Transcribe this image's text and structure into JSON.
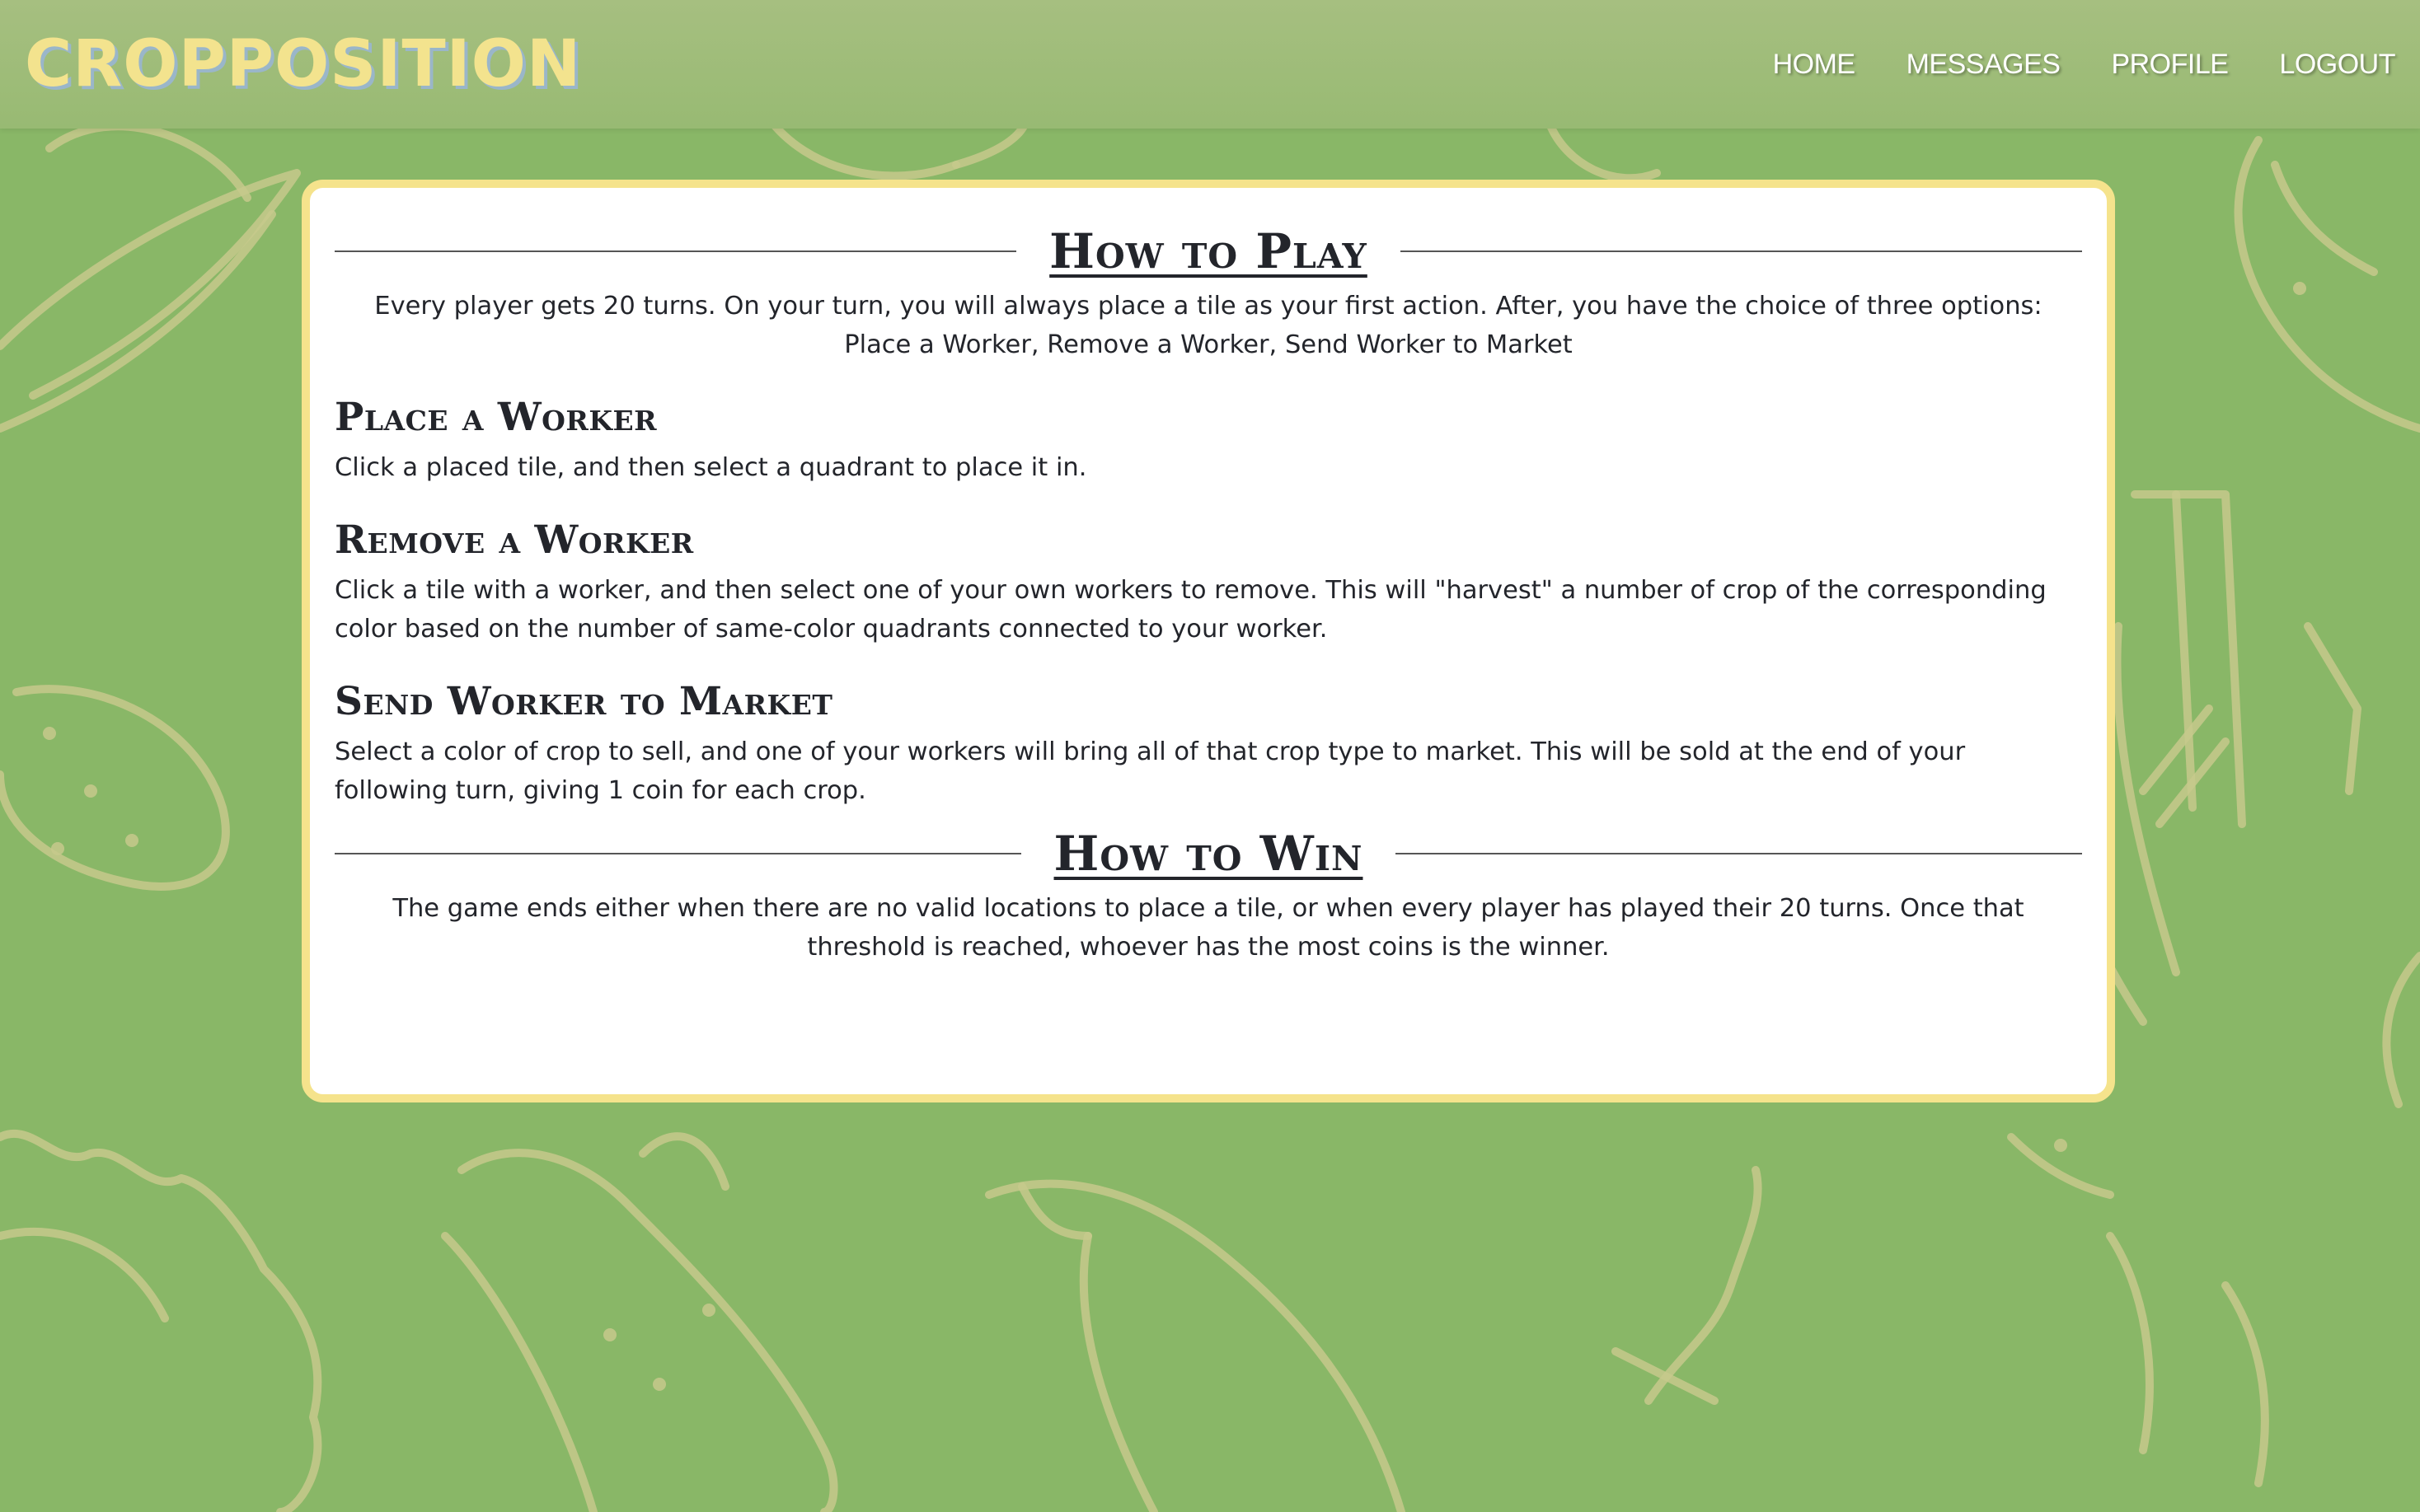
{
  "brand": {
    "name": "CROPPOSITION"
  },
  "nav": {
    "items": [
      {
        "label": "HOME"
      },
      {
        "label": "MESSAGES"
      },
      {
        "label": "PROFILE"
      },
      {
        "label": "LOGOUT"
      }
    ]
  },
  "colors": {
    "background": "#89b767",
    "navbar": "#a6bf80",
    "brand": "#f3e38e",
    "card_border": "#f5e38c",
    "doodle_stroke": "#c7c98c"
  },
  "how_to_play": {
    "title": "How to Play",
    "intro": "Every player gets 20 turns. On your turn, you will always place a tile as your first action. After, you have the choice of three options: Place a Worker, Remove a Worker, Send Worker to Market",
    "sections": [
      {
        "title": "Place a Worker",
        "text": "Click a placed tile, and then select a quadrant to place it in."
      },
      {
        "title": "Remove a Worker",
        "text": "Click a tile with a worker, and then select one of your own workers to remove. This will \"harvest\" a number of crop of the corresponding color based on the number of same-color quadrants connected to your worker."
      },
      {
        "title": "Send Worker to Market",
        "text": "Select a color of crop to sell, and one of your workers will bring all of that crop type to market. This will be sold at the end of your following turn, giving 1 coin for each crop."
      }
    ]
  },
  "how_to_win": {
    "title": "How to Win",
    "text": "The game ends either when there are no valid locations to place a tile, or when every player has played their 20 turns. Once that threshold is reached, whoever has the most coins is the winner."
  },
  "background": {
    "icons": [
      "corn-doodle-icon",
      "potato-doodle-icon",
      "leek-doodle-icon",
      "eggplant-doodle-icon",
      "carrot-doodle-icon",
      "lettuce-doodle-icon",
      "cucumber-doodle-icon"
    ]
  }
}
